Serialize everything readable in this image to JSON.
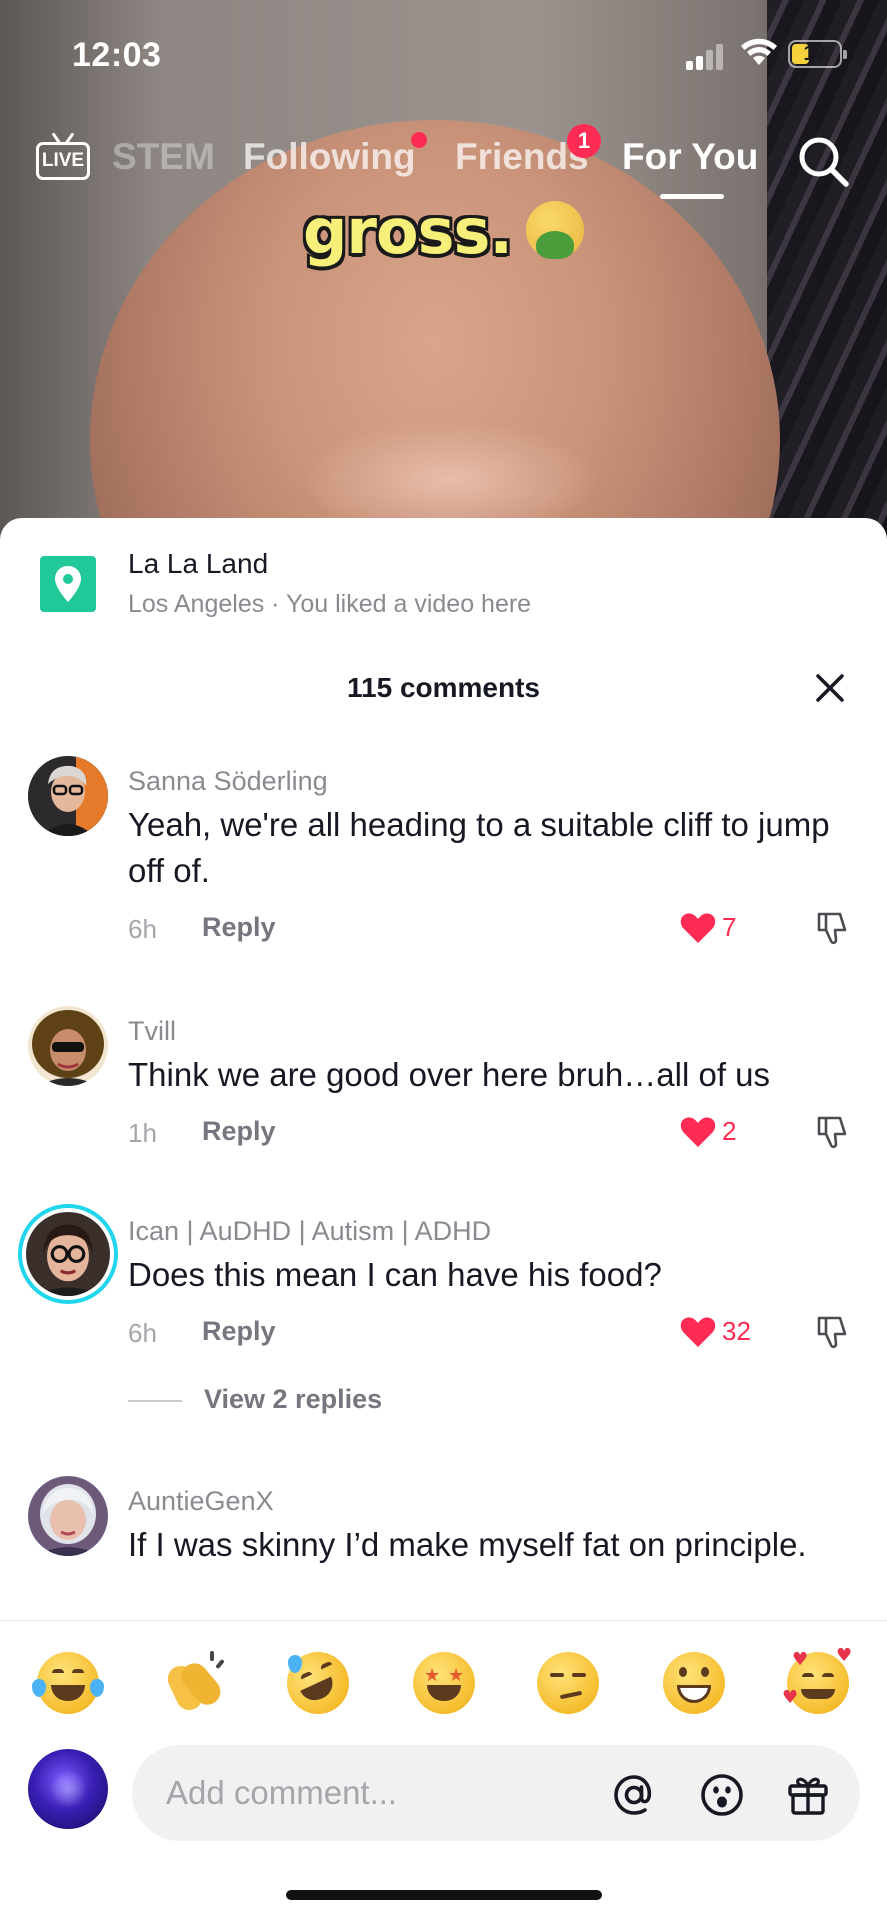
{
  "status_bar": {
    "time": "12:03",
    "battery": "17"
  },
  "top_nav": {
    "tabs": [
      {
        "label": "STEM"
      },
      {
        "label": "Following"
      },
      {
        "label": "Friends"
      },
      {
        "label": "For You"
      }
    ],
    "live_label": "LIVE",
    "friends_badge": "1",
    "active_tab": "For You"
  },
  "video": {
    "caption": "gross."
  },
  "location": {
    "title": "La La Land",
    "subtitle": "Los Angeles · You liked a video here",
    "accent_color": "#20c997"
  },
  "comments_header": {
    "count_label": "115 comments"
  },
  "comments": [
    {
      "author": "Sanna Söderling",
      "text": "Yeah, we're all heading to a suitable cliff to jump off of.",
      "age": "6h",
      "reply_label": "Reply",
      "likes": "7"
    },
    {
      "author": "Tvill",
      "text": "Think we are good over here bruh…all of us",
      "age": "1h",
      "reply_label": "Reply",
      "likes": "2"
    },
    {
      "author": "Ican | AuDHD | Autism | ADHD",
      "text": "Does this mean I can have his food?",
      "age": "6h",
      "reply_label": "Reply",
      "likes": "32",
      "view_replies": "View 2 replies"
    },
    {
      "author": "AuntieGenX",
      "text": "If I was skinny I’d make myself fat on principle."
    }
  ],
  "composer": {
    "emoji_icons": [
      "face-with-tears-of-joy",
      "clapping-hands",
      "rolling-on-floor-laughing",
      "star-struck",
      "smirking-face",
      "grinning-face",
      "smiling-face-with-hearts"
    ],
    "placeholder": "Add comment..."
  },
  "colors": {
    "like_red": "#fe2c55",
    "caption_yellow": "#f6ef7a"
  }
}
